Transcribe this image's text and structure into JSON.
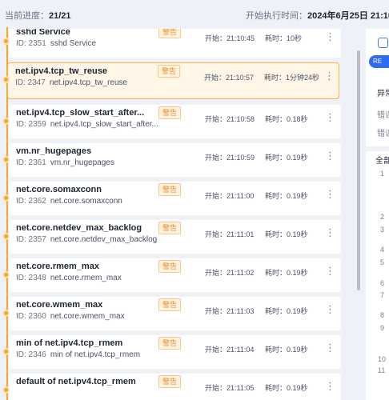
{
  "header": {
    "progress_label": "当前进度：",
    "progress_value": "21/21",
    "start_label": "开始执行时间：",
    "start_value": "2024年6月25日 21:10:4"
  },
  "items": [
    {
      "name": "sshd Service",
      "id_label": "ID: 2351",
      "sub": "sshd Service",
      "badge": "警告",
      "start": "开始：21:10:45",
      "duration": "耗时：10秒",
      "kebab": "⋮"
    },
    {
      "name": "net.ipv4.tcp_tw_reuse",
      "id_label": "ID: 2347",
      "sub": "net.ipv4.tcp_tw_reuse",
      "badge": "警告",
      "start": "开始：21:10:57",
      "duration": "耗时：1分钟24秒",
      "kebab": "⋮"
    },
    {
      "name": "net.ipv4.tcp_slow_start_after...",
      "id_label": "ID: 2359",
      "sub": "net.ipv4.tcp_slow_start_after...",
      "badge": "警告",
      "start": "开始：21:10:58",
      "duration": "耗时：0.18秒",
      "kebab": "⋮"
    },
    {
      "name": "vm.nr_hugepages",
      "id_label": "ID: 2361",
      "sub": "vm.nr_hugepages",
      "badge": "警告",
      "start": "开始：21:10:59",
      "duration": "耗时：0.19秒",
      "kebab": "⋮"
    },
    {
      "name": "net.core.somaxconn",
      "id_label": "ID: 2362",
      "sub": "net.core.somaxconn",
      "badge": "警告",
      "start": "开始：21:11:00",
      "duration": "耗时：0.19秒",
      "kebab": "⋮"
    },
    {
      "name": "net.core.netdev_max_backlog",
      "id_label": "ID: 2357",
      "sub": "net.core.netdev_max_backlog",
      "badge": "警告",
      "start": "开始：21:11:01",
      "duration": "耗时：0.19秒",
      "kebab": "⋮"
    },
    {
      "name": "net.core.rmem_max",
      "id_label": "ID: 2348",
      "sub": "net.core.rmem_max",
      "badge": "警告",
      "start": "开始：21:11:02",
      "duration": "耗时：0.19秒",
      "kebab": "⋮"
    },
    {
      "name": "net.core.wmem_max",
      "id_label": "ID: 2360",
      "sub": "net.core.wmem_max",
      "badge": "警告",
      "start": "开始：21:11:03",
      "duration": "耗时：0.19秒",
      "kebab": "⋮"
    },
    {
      "name": "min of net.ipv4.tcp_rmem",
      "id_label": "ID: 2346",
      "sub": "min of net.ipv4.tcp_rmem",
      "badge": "警告",
      "start": "开始：21:11:04",
      "duration": "耗时：0.19秒",
      "kebab": "⋮"
    },
    {
      "name": "default of net.ipv4.tcp_rmem",
      "id_label": "",
      "sub": "",
      "badge": "警告",
      "start": "开始：21:11:05",
      "duration": "耗时：0.19秒",
      "kebab": "⋮"
    }
  ],
  "right_panel": {
    "tag": "RE",
    "section1": "异常",
    "row1": "错误",
    "row2": "错误",
    "section2": "全部",
    "line_numbers": [
      "1",
      "2",
      "3",
      "4",
      "5",
      "6",
      "7",
      "8",
      "9",
      "10",
      "11"
    ]
  },
  "colors": {
    "accent": "#f5a623",
    "active_bg": "#fff6e8",
    "badge_text": "#f08c2a",
    "primary": "#2f6df0"
  }
}
